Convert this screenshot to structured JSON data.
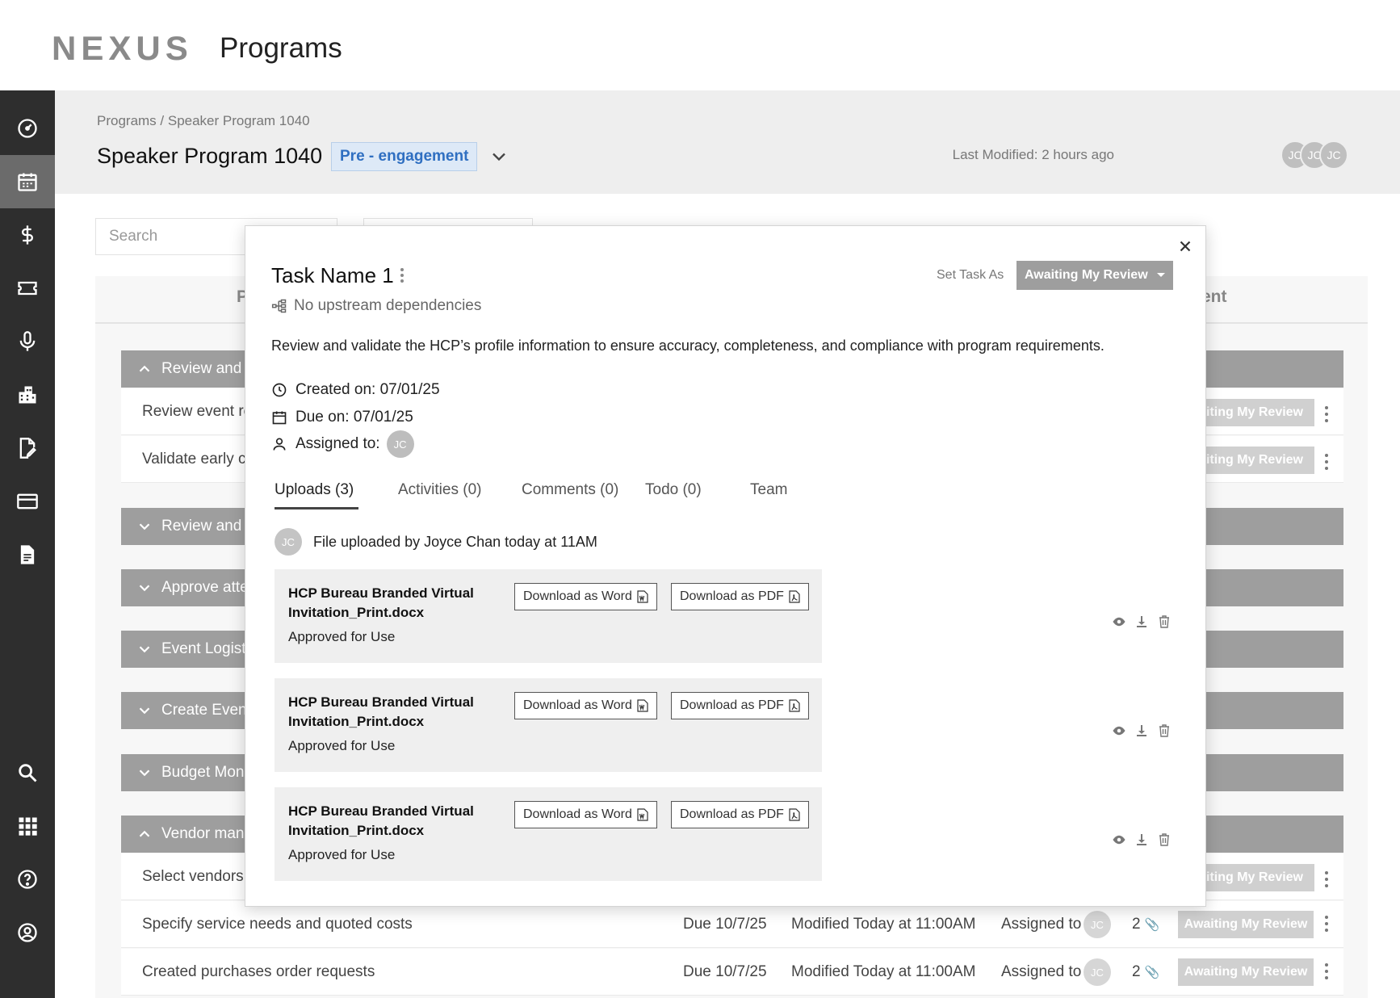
{
  "header": {
    "logo": "NEXUS",
    "title": "Programs"
  },
  "sidebar": {
    "items": [
      {
        "icon": "dashboard-icon",
        "active": false
      },
      {
        "icon": "calendar-icon",
        "active": true
      },
      {
        "icon": "dollar-icon",
        "active": false
      },
      {
        "icon": "ticket-icon",
        "active": false
      },
      {
        "icon": "microphone-icon",
        "active": false
      },
      {
        "icon": "buildings-icon",
        "active": false
      },
      {
        "icon": "document-edit-icon",
        "active": false
      },
      {
        "icon": "credit-card-icon",
        "active": false
      },
      {
        "icon": "file-icon",
        "active": false
      },
      {
        "icon": "search-icon",
        "active": false
      },
      {
        "icon": "apps-grid-icon",
        "active": false
      },
      {
        "icon": "help-icon",
        "active": false
      },
      {
        "icon": "user-account-icon",
        "active": false
      }
    ]
  },
  "page": {
    "breadcrumb": "Programs / Speaker Program 1040",
    "title": "Speaker Program 1040",
    "stage": "Pre - engagement",
    "last_modified": "Last Modified: 2 hours ago",
    "avatars": [
      "JC",
      "JC",
      "JC"
    ]
  },
  "background": {
    "search_placeholder": "Search",
    "tab_fragment_left": "P",
    "tab_fragment_right": "ent",
    "groups": [
      {
        "label": "Review and a",
        "expanded": true
      },
      {
        "label": "Review and C",
        "expanded": false
      },
      {
        "label": "Approve atte",
        "expanded": false
      },
      {
        "label": "Event Logisti",
        "expanded": false
      },
      {
        "label": "Create Event",
        "expanded": false
      },
      {
        "label": "Budget Moni",
        "expanded": false
      },
      {
        "label": "Vendor mana",
        "expanded": true
      }
    ],
    "rows_partial": [
      {
        "text": "Review event re",
        "status": "aiting My Review"
      },
      {
        "text": "Validate early co",
        "status": "aiting My Review"
      },
      {
        "text": "Select vendors (",
        "status": "aiting My Review"
      }
    ],
    "rows_full": [
      {
        "text": "Specify service needs and quoted costs",
        "due": "Due 10/7/25",
        "modified": "Modified Today at 11:00AM",
        "assigned": "Assigned to",
        "avatar": "JC",
        "count": "2",
        "status": "Awaiting My Review"
      },
      {
        "text": "Created purchases order requests",
        "due": "Due 10/7/25",
        "modified": "Modified Today at 11:00AM",
        "assigned": "Assigned to",
        "avatar": "JC",
        "count": "2",
        "status": "Awaiting My Review"
      }
    ]
  },
  "modal": {
    "title": "Task Name 1",
    "set_task_label": "Set Task As",
    "status": "Awaiting My Review",
    "dependencies": "No upstream dependencies",
    "description": "Review and validate the HCP’s profile information to ensure accuracy, completeness, and compliance with program requirements.",
    "created": "Created on: 07/01/25",
    "due": "Due on: 07/01/25",
    "assigned": "Assigned to:",
    "assignee_avatar": "JC",
    "tabs": [
      "Uploads (3)",
      "Activities (0)",
      "Comments (0)",
      "Todo (0)",
      "Team"
    ],
    "active_tab": 0,
    "upload_note": "File uploaded by Joyce Chan today at 11AM",
    "uploader_avatar": "JC",
    "files": [
      {
        "name": "HCP Bureau Branded Virtual Invitation_Print.docx",
        "status": "Approved for Use",
        "word_label": "Download as Word",
        "pdf_label": "Download as PDF"
      },
      {
        "name": "HCP Bureau Branded Virtual Invitation_Print.docx",
        "status": "Approved for Use",
        "word_label": "Download as Word",
        "pdf_label": "Download as PDF"
      },
      {
        "name": "HCP Bureau Branded Virtual Invitation_Print.docx",
        "status": "Approved for Use",
        "word_label": "Download as Word",
        "pdf_label": "Download as PDF"
      }
    ]
  },
  "colors": {
    "sidebar_bg": "#2e2e2e",
    "sidebar_active": "#6b6b6b",
    "stage_badge_text": "#2f6fc1",
    "group_bar": "#9e9e9e"
  }
}
